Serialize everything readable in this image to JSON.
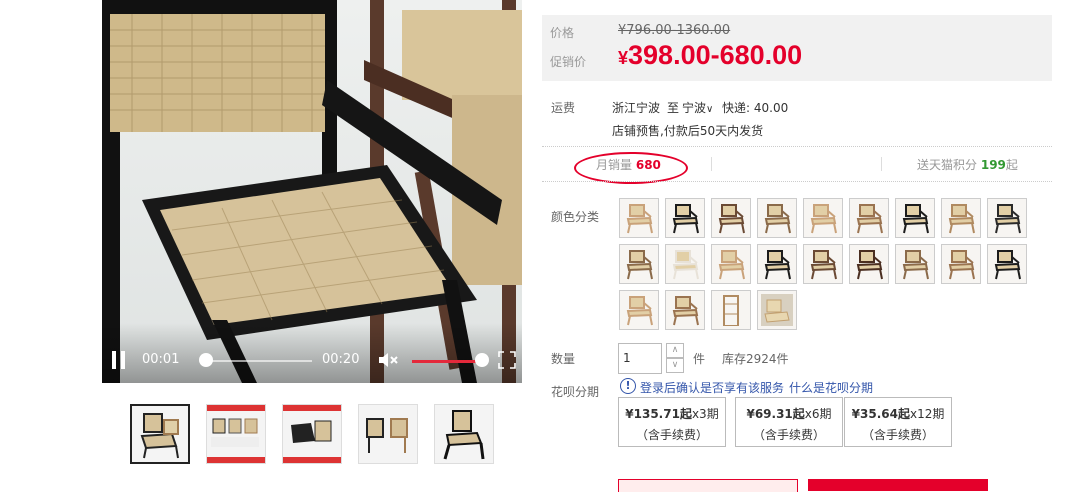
{
  "video": {
    "current_time": "00:01",
    "duration": "00:20",
    "progress_fraction": 0.05,
    "volume_fraction": 1.0
  },
  "gallery": {
    "thumbnail_count": 5,
    "active_index": 0
  },
  "price": {
    "label": "价格",
    "original": "¥796.00-1360.00",
    "promo_label": "促销价",
    "promo_currency": "¥",
    "promo_value": "398.00-680.00"
  },
  "shipping": {
    "label": "运费",
    "from": "浙江宁波",
    "to_prefix": "至",
    "to": "宁波",
    "express": "快递: 40.00",
    "presale_note": "店铺预售,付款后50天内发货"
  },
  "stats": {
    "monthly_sales_label": "月销量",
    "monthly_sales_value": "680",
    "points_prefix": "送天猫积分",
    "points_value": "199",
    "points_suffix": "起"
  },
  "color": {
    "label": "颜色分类",
    "option_count": 22
  },
  "quantity": {
    "label": "数量",
    "value": "1",
    "unit": "件",
    "stock": "库存2924件"
  },
  "huabei": {
    "label": "花呗分期",
    "note": "登录后确认是否享有该服务",
    "link": "什么是花呗分期",
    "plans": [
      {
        "amount": "¥135.71起",
        "periods": "x3期",
        "fee": "（含手续费）"
      },
      {
        "amount": "¥69.31起",
        "periods": "x6期",
        "fee": "（含手续费）"
      },
      {
        "amount": "¥35.64起",
        "periods": "x12期",
        "fee": "（含手续费）"
      }
    ]
  },
  "colors": {
    "accent": "#e4002b",
    "link": "#3355aa",
    "points": "#339933"
  }
}
